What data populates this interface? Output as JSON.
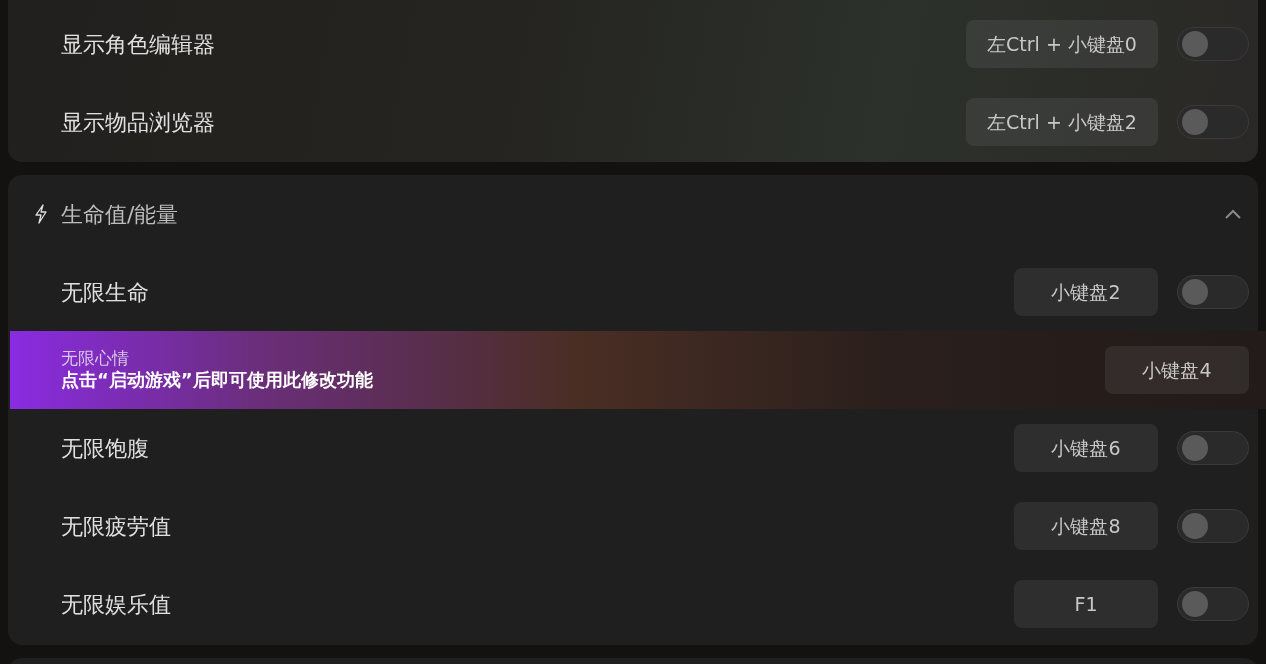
{
  "sections": [
    {
      "rows": [
        {
          "kind": "toggle",
          "label": "显示角色编辑器",
          "hotkey": "左Ctrl + 小键盘0",
          "on": false
        },
        {
          "kind": "toggle",
          "label": "显示物品浏览器",
          "hotkey": "左Ctrl + 小键盘2",
          "on": false
        }
      ]
    },
    {
      "title": "生命值/能量",
      "expanded": true,
      "rows": [
        {
          "kind": "toggle",
          "label": "无限生命",
          "hotkey": "小键盘2",
          "on": false
        },
        {
          "kind": "locked",
          "label": "无限心情",
          "hint": "点击“启动游戏”后即可使用此修改功能",
          "hotkey": "小键盘4"
        },
        {
          "kind": "toggle",
          "label": "无限饱腹",
          "hotkey": "小键盘6",
          "on": false
        },
        {
          "kind": "toggle",
          "label": "无限疲劳值",
          "hotkey": "小键盘8",
          "on": false
        },
        {
          "kind": "toggle",
          "label": "无限娱乐值",
          "hotkey": "F1",
          "on": false
        }
      ]
    }
  ]
}
